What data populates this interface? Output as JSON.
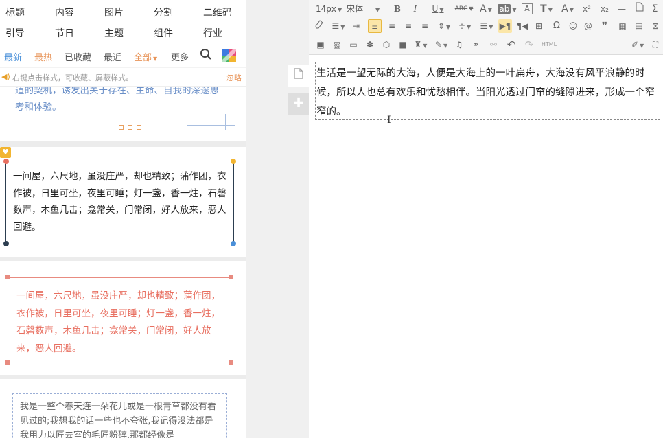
{
  "categories_row1": [
    "标题",
    "内容",
    "图片",
    "分割",
    "二维码"
  ],
  "categories_row2": [
    "引导",
    "节日",
    "主题",
    "组件",
    "行业"
  ],
  "filters": {
    "newest": "最新",
    "hot": "最热",
    "favorited": "已收藏",
    "recent": "最近",
    "all": "全部",
    "more": "更多"
  },
  "tip": {
    "text": "右键点击样式，可收藏、屏蔽样式。",
    "ignore": "忽略"
  },
  "cards": [
    {
      "text": "道的契机，诱发出关于存在、生命、自我的深邃思考和体验。"
    },
    {
      "text": "一间屋，六尺地，虽没庄严，却也精致；蒲作团，衣作被，日里可坐，夜里可睡；灯一盏，香一炷，石磬数声，木鱼几击；龛常关，门常闭，好人放来，恶人回避。"
    },
    {
      "text": "一间屋，六尺地，虽没庄严，却也精致；蒲作团，衣作被，日里可坐，夜里可睡；灯一盏，香一炷，石磬数声，木鱼几击；龛常关，门常闭，好人放来，恶人回避。"
    },
    {
      "text": "我是一整个春天连一朵花儿或是一根青草都没有看见过的;我想我的话一些也不夸张,我记得没法都是我用力以匠去室的毛匠粉碎,那都经像是"
    }
  ],
  "toolbar": {
    "font_size": "14px",
    "font_family": "宋体",
    "bold": "B",
    "italic": "I",
    "underline": "U",
    "strike": "ABC",
    "font_color": "A",
    "bg_color": "ab",
    "clear": "A",
    "text_style": "T",
    "text_size": "A",
    "superscript": "x²",
    "subscript": "x₂",
    "omega": "Ω",
    "html": "HTML"
  },
  "editor": {
    "content": "生活是一望无际的大海，人便是大海上的一叶扁舟，大海没有风平浪静的时候，所以人也总有欢乐和忧愁相伴。当阳光透过门帘的缝隙进来，形成一个窄窄的。"
  },
  "colors": {
    "accent_blue": "#4a90d9",
    "accent_orange": "#e8955a",
    "card_red": "#e86f60"
  }
}
